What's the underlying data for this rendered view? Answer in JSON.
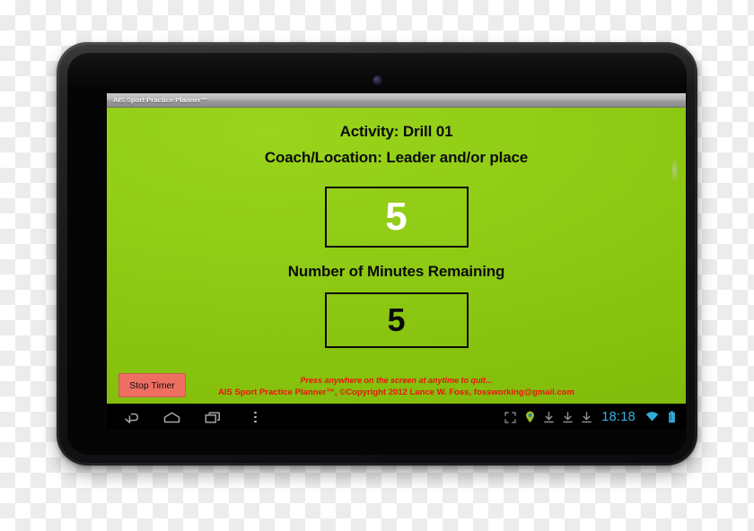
{
  "window": {
    "title": "AIS Sport Practice Planner™"
  },
  "app": {
    "activity_line": "Activity: Drill 01",
    "coach_location_line": "Coach/Location: Leader and/or place",
    "countdown_value": "5",
    "remaining_label": "Number of Minutes Remaining",
    "minutes_value": "5",
    "stop_timer_label": "Stop Timer",
    "quit_note": "Press anywhere on the screen at anytime to quit...",
    "copyright_note": "AIS Sport Practice Planner™, ©Copyright 2012 Lance W. Foss, fossworking@gmail.com",
    "colors": {
      "background_green": "#90cc16",
      "stop_button_red": "#ef6e62",
      "footer_text_red": "#ee1111",
      "countdown_text": "#ffffff",
      "minutes_text": "#0a0a0a"
    }
  },
  "navbar": {
    "back_icon": "back-arrow-icon",
    "home_icon": "home-icon",
    "recents_icon": "recent-apps-icon",
    "menu_icon": "overflow-menu-icon",
    "status": {
      "fullscreen_icon": "fullscreen-expand-icon",
      "location_icon": "location-pin-icon",
      "download_icon": "download-arrow-icon",
      "download_count": 3,
      "clock": "18:18",
      "wifi_icon": "wifi-icon",
      "battery_icon": "battery-icon",
      "clock_color": "#33b5e5"
    }
  },
  "device": {
    "type": "android-tablet",
    "camera": "front-camera"
  }
}
